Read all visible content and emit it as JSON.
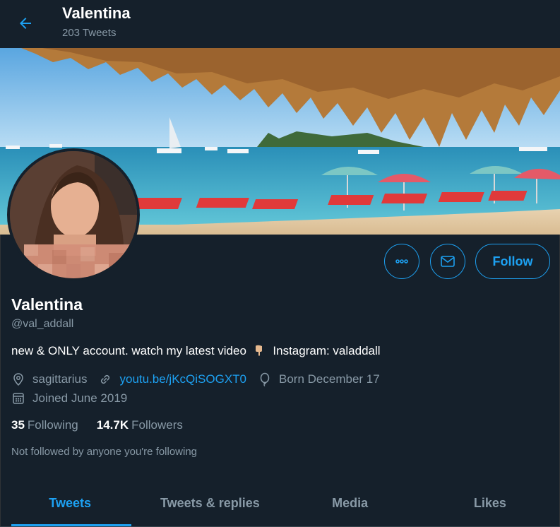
{
  "header": {
    "title": "Valentina",
    "subtitle": "203 Tweets",
    "back_icon": "arrow-left-icon"
  },
  "profile": {
    "name": "Valentina",
    "handle": "@val_addall",
    "bio_before": "new & ONLY account. watch my latest video",
    "bio_emoji": "pointing-down-hand-emoji",
    "bio_after": "Instagram: valaddall",
    "location": "sagittarius",
    "website": "youtu.be/jKcQiSOGXT0",
    "birthday": "Born December 17",
    "joined": "Joined June 2019",
    "following_count": "35",
    "following_label": "Following",
    "followers_count": "14.7K",
    "followers_label": "Followers",
    "not_followed_text": "Not followed by anyone you're following"
  },
  "actions": {
    "more_icon": "more-icon",
    "message_icon": "envelope-icon",
    "follow_label": "Follow"
  },
  "tabs": [
    {
      "label": "Tweets",
      "active": true
    },
    {
      "label": "Tweets & replies",
      "active": false
    },
    {
      "label": "Media",
      "active": false
    },
    {
      "label": "Likes",
      "active": false
    }
  ],
  "colors": {
    "background": "#15202b",
    "accent": "#1da1f2",
    "secondary_text": "#8899a6"
  }
}
